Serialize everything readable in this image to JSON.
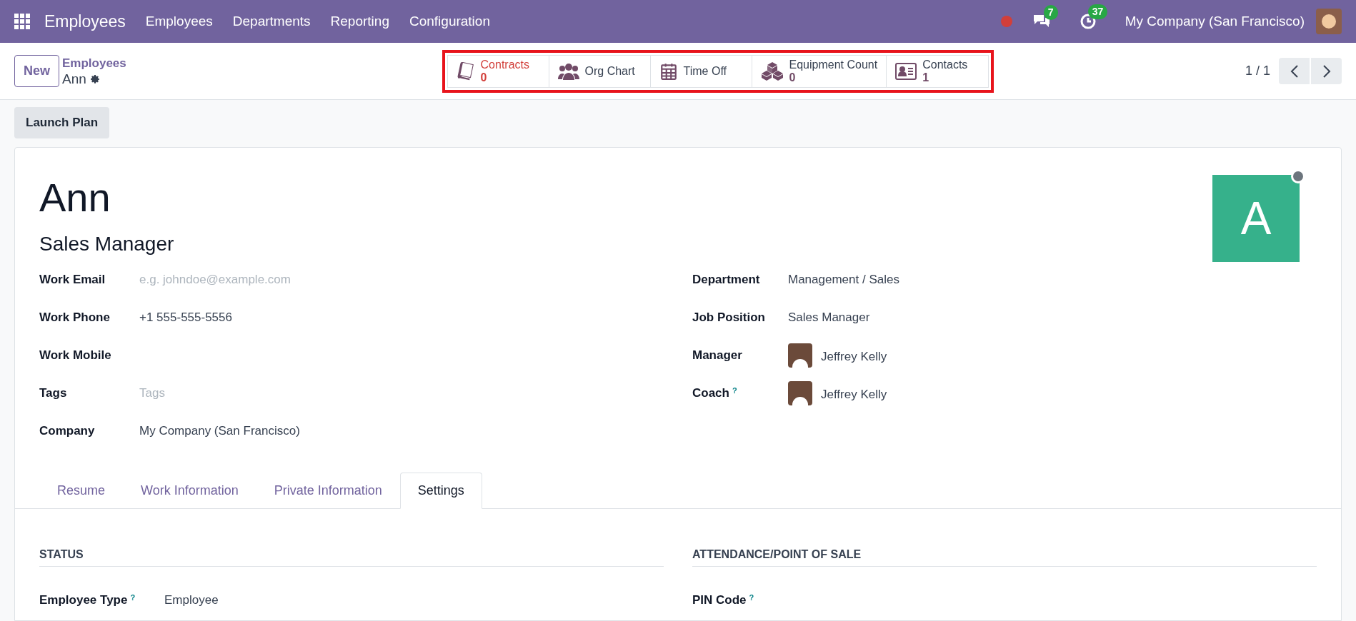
{
  "navbar": {
    "app_title": "Employees",
    "menus": [
      "Employees",
      "Departments",
      "Reporting",
      "Configuration"
    ],
    "messages_count": "7",
    "activities_count": "37",
    "company": "My Company (San Francisco)"
  },
  "control_panel": {
    "new_button": "New",
    "breadcrumb_parent": "Employees",
    "breadcrumb_current": "Ann",
    "pager": "1 / 1"
  },
  "smart_buttons": [
    {
      "kind": "counter",
      "label": "Contracts",
      "count": "0",
      "warning": true
    },
    {
      "kind": "plain",
      "label": "Org Chart"
    },
    {
      "kind": "plain",
      "label": "Time Off"
    },
    {
      "kind": "counter",
      "label": "Equipment Count",
      "count": "0",
      "warning": false
    },
    {
      "kind": "counter",
      "label": "Contacts",
      "count": "1",
      "warning": false
    }
  ],
  "launch_plan_button": "Launch Plan",
  "employee": {
    "name": "Ann",
    "job_title": "Sales Manager",
    "avatar_letter": "A"
  },
  "left_fields": [
    {
      "label": "Work Email",
      "placeholder": "e.g. johndoe@example.com"
    },
    {
      "label": "Work Phone",
      "value": "+1 555-555-5556"
    },
    {
      "label": "Work Mobile"
    },
    {
      "label": "Tags",
      "placeholder": "Tags"
    },
    {
      "label": "Company",
      "value": "My Company (San Francisco)"
    }
  ],
  "right_fields": [
    {
      "label": "Department",
      "value": "Management / Sales"
    },
    {
      "label": "Job Position",
      "value": "Sales Manager"
    },
    {
      "label": "Manager",
      "value": "Jeffrey Kelly",
      "kind": "user"
    },
    {
      "label": "Coach",
      "help": "?",
      "value": "Jeffrey Kelly",
      "kind": "user"
    }
  ],
  "tabs": [
    {
      "label": "Resume",
      "selected": false
    },
    {
      "label": "Work Information",
      "selected": false
    },
    {
      "label": "Private Information",
      "selected": false
    },
    {
      "label": "Settings",
      "selected": true
    }
  ],
  "settings": {
    "left_heading": "STATUS",
    "right_heading": "ATTENDANCE/POINT OF SALE",
    "left_fields": [
      {
        "label": "Employee Type",
        "help": "?",
        "value": "Employee"
      }
    ],
    "right_fields": [
      {
        "label": "PIN Code",
        "help": "?"
      }
    ]
  }
}
